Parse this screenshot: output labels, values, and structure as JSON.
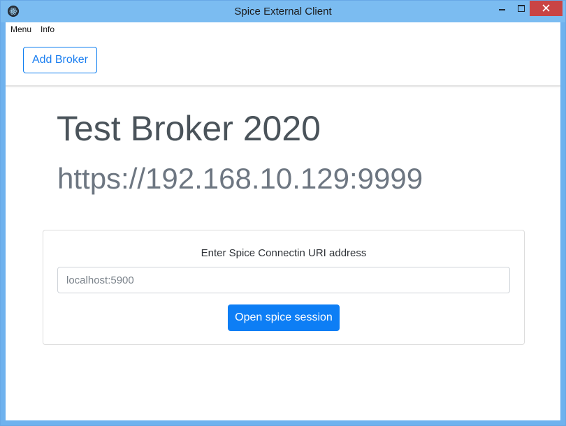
{
  "window": {
    "title": "Spice External Client"
  },
  "menubar": {
    "items": [
      {
        "label": "Menu"
      },
      {
        "label": "Info"
      }
    ]
  },
  "navbar": {
    "add_broker_label": "Add Broker"
  },
  "broker": {
    "name": "Test Broker 2020",
    "url": "https://192.168.10.129:9999"
  },
  "connect_card": {
    "label": "Enter Spice Connectin URI address",
    "uri_placeholder": "localhost:5900",
    "uri_value": "",
    "open_button_label": "Open spice session"
  },
  "colors": {
    "accent": "#0d7ef5",
    "titlebar": "#7bbcf1",
    "close_button": "#c94444"
  },
  "icons": {
    "app": "electron-icon",
    "minimize": "minimize-icon",
    "maximize": "maximize-icon",
    "close": "close-icon"
  }
}
